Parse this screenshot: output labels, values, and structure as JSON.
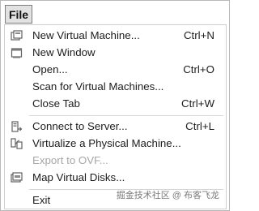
{
  "menubar": {
    "file_label": "File"
  },
  "menu": {
    "items": [
      {
        "label": "New Virtual Machine...",
        "shortcut": "Ctrl+N",
        "icon": "new-vm-icon"
      },
      {
        "label": "New Window",
        "shortcut": "",
        "icon": "new-window-icon"
      },
      {
        "label": "Open...",
        "shortcut": "Ctrl+O"
      },
      {
        "label": "Scan for Virtual Machines...",
        "shortcut": ""
      },
      {
        "label": "Close Tab",
        "shortcut": "Ctrl+W"
      },
      {
        "label": "Connect to Server...",
        "shortcut": "Ctrl+L",
        "icon": "connect-server-icon"
      },
      {
        "label": "Virtualize a Physical Machine...",
        "shortcut": "",
        "icon": "virtualize-physical-icon"
      },
      {
        "label": "Export to OVF...",
        "shortcut": "",
        "disabled": true
      },
      {
        "label": "Map Virtual Disks...",
        "shortcut": "",
        "icon": "map-disks-icon"
      },
      {
        "label": "Exit",
        "shortcut": ""
      }
    ]
  },
  "watermark": {
    "text": "掘金技术社区 @ 布客飞龙"
  },
  "colors": {
    "menu_text": "#1c1c1c",
    "disabled_text": "#a7a7a7",
    "separator": "#d7d7d7"
  }
}
